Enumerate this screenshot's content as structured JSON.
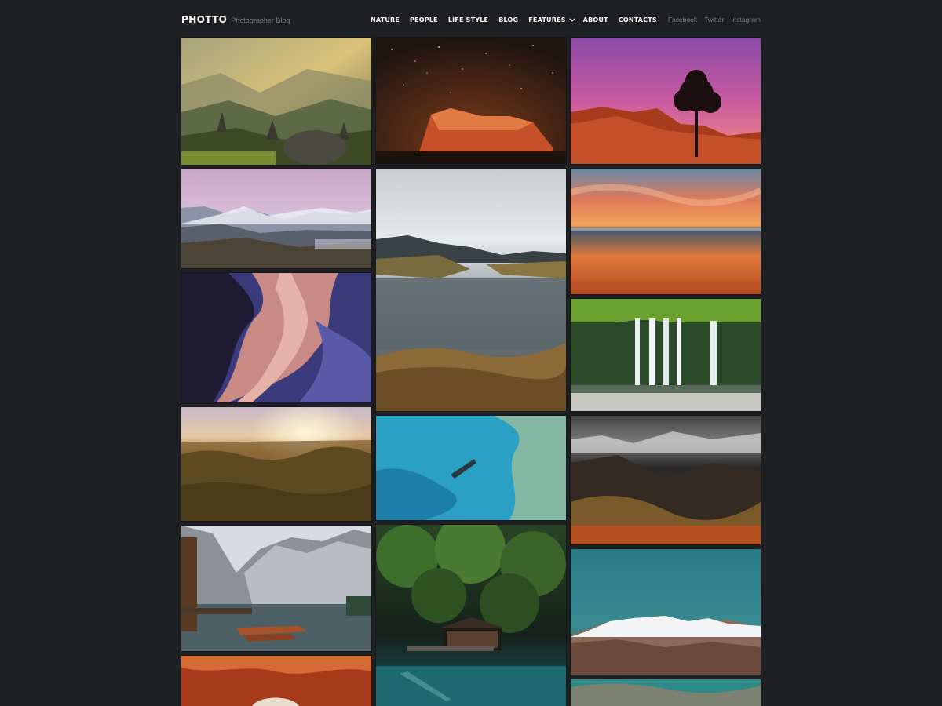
{
  "brand": {
    "logo": "PHOTTO",
    "tagline": "Photographer Blog"
  },
  "nav": {
    "items": [
      "NATURE",
      "PEOPLE",
      "LIFE STYLE",
      "BLOG",
      "FEATURES",
      "ABOUT",
      "CONTACTS"
    ]
  },
  "social": [
    "Facebook",
    "Twitter",
    "Instagram"
  ],
  "colors": {
    "background": "#1e1f22",
    "text": "#ffffff",
    "muted": "#7f8186"
  }
}
